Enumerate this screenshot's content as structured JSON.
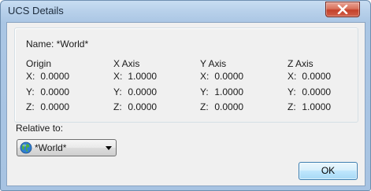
{
  "window": {
    "title": "UCS Details"
  },
  "name_line": "Name: *World*",
  "columns": [
    {
      "header": "Origin",
      "rows": [
        {
          "label": "X:",
          "value": "0.0000"
        },
        {
          "label": "Y:",
          "value": "0.0000"
        },
        {
          "label": "Z:",
          "value": "0.0000"
        }
      ]
    },
    {
      "header": "X Axis",
      "rows": [
        {
          "label": "X:",
          "value": "1.0000"
        },
        {
          "label": "Y:",
          "value": "0.0000"
        },
        {
          "label": "Z:",
          "value": "0.0000"
        }
      ]
    },
    {
      "header": "Y Axis",
      "rows": [
        {
          "label": "X:",
          "value": "0.0000"
        },
        {
          "label": "Y:",
          "value": "1.0000"
        },
        {
          "label": "Z:",
          "value": "0.0000"
        }
      ]
    },
    {
      "header": "Z Axis",
      "rows": [
        {
          "label": "X:",
          "value": "0.0000"
        },
        {
          "label": "Y:",
          "value": "0.0000"
        },
        {
          "label": "Z:",
          "value": "1.0000"
        }
      ]
    }
  ],
  "relative": {
    "label": "Relative to:",
    "selected": "*World*",
    "icon": "globe-icon"
  },
  "buttons": {
    "ok": "OK",
    "close_icon": "close-icon"
  }
}
